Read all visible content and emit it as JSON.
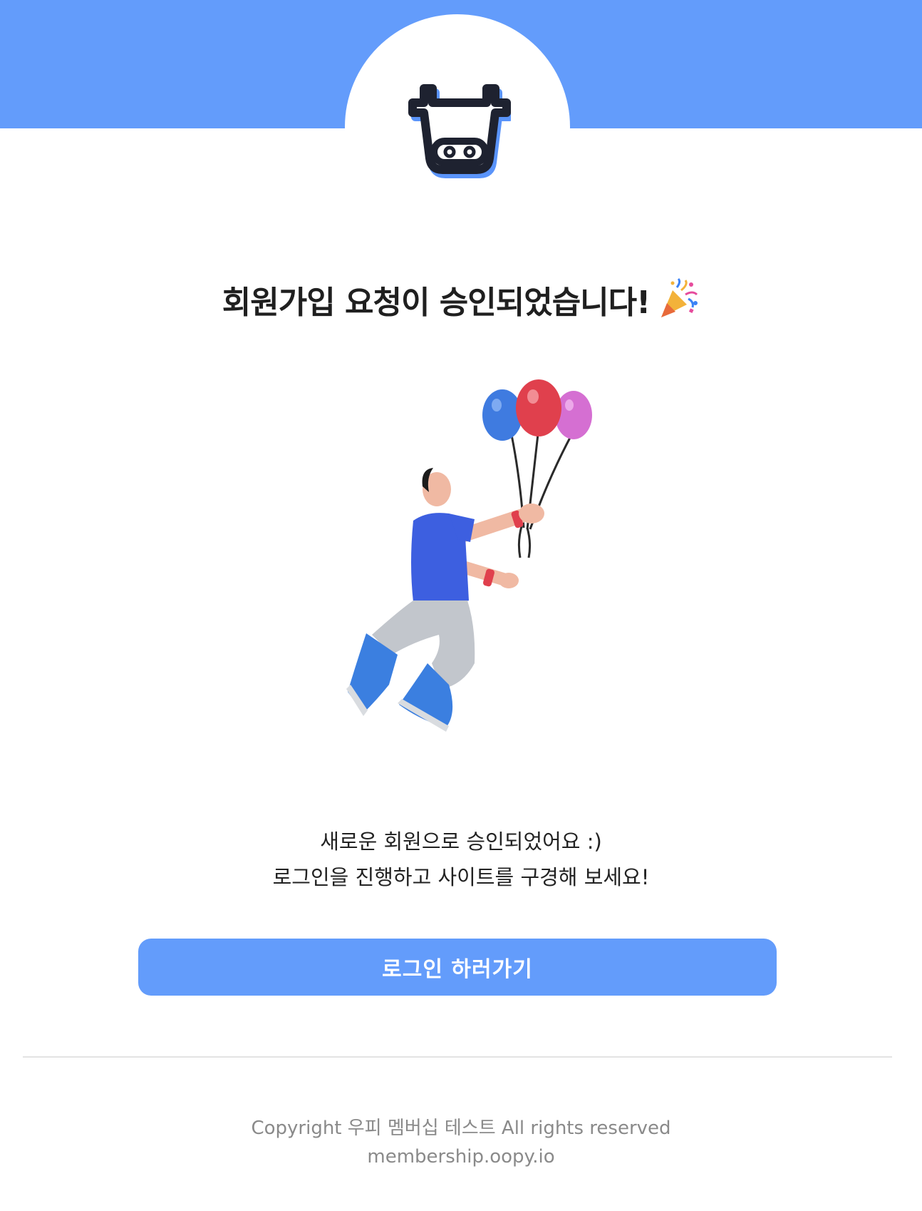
{
  "header": {
    "logo_icon": "cow-face-icon",
    "band_color": "#639cfb"
  },
  "headline": {
    "text": "회원가입 요청이 승인되었습니다!",
    "emoji_icon": "party-popper-icon"
  },
  "illustration": {
    "icon": "person-floating-with-balloons-illustration"
  },
  "message": {
    "line1": "새로운 회원으로 승인되었어요 :)",
    "line2": "로그인을 진행하고 사이트를 구경해 보세요!"
  },
  "button": {
    "label": "로그인 하러가기",
    "color": "#639cfb"
  },
  "footer": {
    "copyright": "Copyright 우피 멤버십 테스트 All rights reserved",
    "domain": "membership.oopy.io"
  }
}
